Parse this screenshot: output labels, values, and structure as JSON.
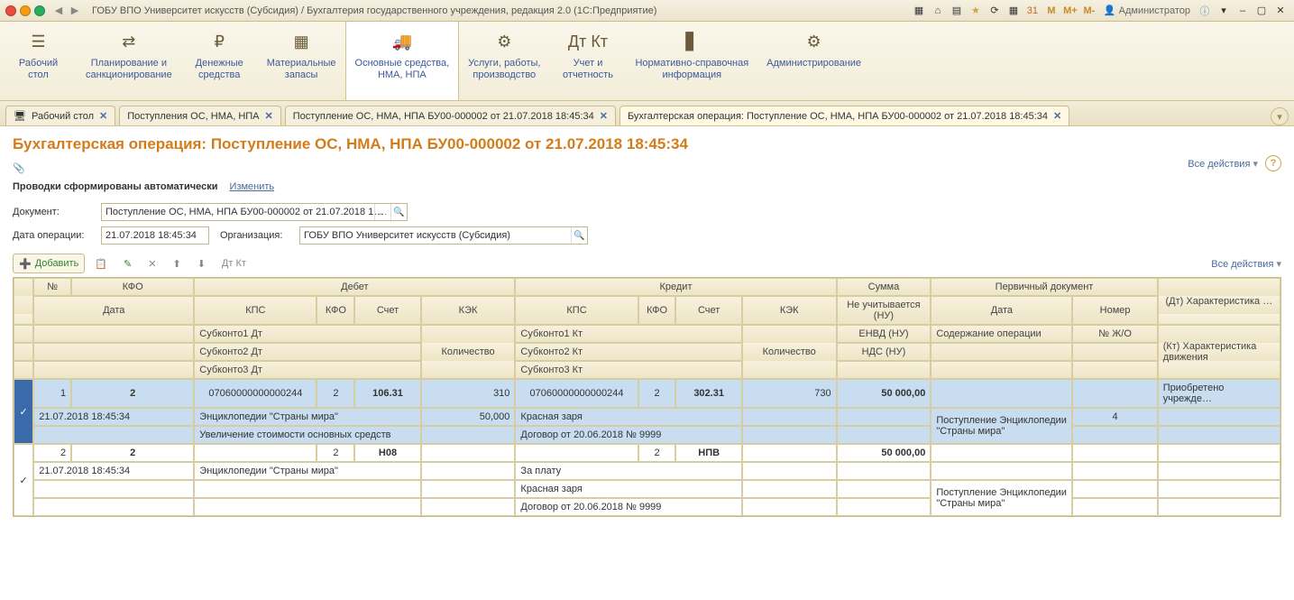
{
  "titlebar": {
    "title": "ГОБУ ВПО Университет искусств (Субсидия) / Бухгалтерия государственного учреждения, редакция 2.0  (1С:Предприятие)",
    "admin": "Администратор"
  },
  "nav": {
    "items": [
      {
        "label": "Рабочий\nстол"
      },
      {
        "label": "Планирование и\nсанкционирование"
      },
      {
        "label": "Денежные\nсредства"
      },
      {
        "label": "Материальные\nзапасы"
      },
      {
        "label": "Основные средства,\nНМА, НПА"
      },
      {
        "label": "Услуги, работы,\nпроизводство"
      },
      {
        "label": "Учет и\nотчетность"
      },
      {
        "label": "Нормативно-справочная\nинформация"
      },
      {
        "label": "Администрирование"
      }
    ]
  },
  "tabs": {
    "items": [
      {
        "label": "Рабочий стол"
      },
      {
        "label": "Поступления ОС, НМА, НПА"
      },
      {
        "label": "Поступление ОС, НМА, НПА БУ00-000002 от 21.07.2018 18:45:34"
      },
      {
        "label": "Бухгалтерская операция: Поступление ОС, НМА, НПА БУ00-000002 от 21.07.2018 18:45:34"
      }
    ]
  },
  "page": {
    "title": "Бухгалтерская операция: Поступление ОС, НМА, НПА БУ00-000002 от 21.07.2018 18:45:34",
    "all_actions": "Все действия",
    "auto_text": "Проводки сформированы автоматически",
    "change_link": "Изменить",
    "doc_label": "Документ:",
    "doc_value": "Поступление ОС, НМА, НПА БУ00-000002 от 21.07.2018 1…",
    "date_label": "Дата операции:",
    "date_value": "21.07.2018 18:45:34",
    "org_label": "Организация:",
    "org_value": "ГОБУ ВПО Университет искусств (Субсидия)",
    "add_btn": "Добавить"
  },
  "headers": {
    "no": "№",
    "kfo": "КФО",
    "debit": "Дебет",
    "credit": "Кредит",
    "sum": "Сумма",
    "prim_doc": "Первичный документ",
    "dt_char": "(Дт) Характеристика …",
    "date": "Дата",
    "kps": "КПС",
    "kfo2": "КФО",
    "acc": "Счет",
    "kek": "КЭК",
    "no_nu": "Не учитывается (НУ)",
    "doc_date": "Дата",
    "doc_no": "Номер",
    "kt_char": "(Кт) Характеристика\nдвижения",
    "sub1dt": "Субконто1 Дт",
    "sub2dt": "Субконто2 Дт",
    "sub3dt": "Субконто3 Дт",
    "qty": "Количество",
    "sub1kt": "Субконто1 Кт",
    "sub2kt": "Субконто2 Кт",
    "sub3kt": "Субконто3 Кт",
    "envd": "ЕНВД (НУ)",
    "content": "Содержание операции",
    "jo": "№ Ж/О",
    "nds": "НДС (НУ)"
  },
  "rows": [
    {
      "no": "1",
      "kfo": "2",
      "date": "21.07.2018 18:45:34",
      "dt_kps": "07060000000000244",
      "dt_kfo": "2",
      "dt_acc": "106.31",
      "dt_kek": "310",
      "kt_kps": "07060000000000244",
      "kt_kfo": "2",
      "kt_acc": "302.31",
      "kt_kek": "730",
      "sum": "50 000,00",
      "dt_char": "Приобретено учрежде…",
      "sub1dt": "Энциклопедии \"Страны мира\"",
      "qty_dt": "50,000",
      "sub1kt": "Красная заря",
      "sub2dt": "Увеличение стоимости основных средств",
      "sub2kt": "Договор от 20.06.2018 № 9999",
      "content": "Поступление Энциклопедии\n\"Страны мира\"",
      "jo": "4"
    },
    {
      "no": "2",
      "kfo": "2",
      "date": "21.07.2018 18:45:34",
      "dt_kfo": "2",
      "dt_acc": "Н08",
      "kt_kfo": "2",
      "kt_acc": "НПВ",
      "sum": "50 000,00",
      "sub1dt": "Энциклопедии \"Страны мира\"",
      "sub1kt": "За плату",
      "sub2kt": "Красная заря",
      "sub3kt": "Договор от 20.06.2018 № 9999",
      "content": "Поступление Энциклопедии\n\"Страны мира\""
    }
  ]
}
